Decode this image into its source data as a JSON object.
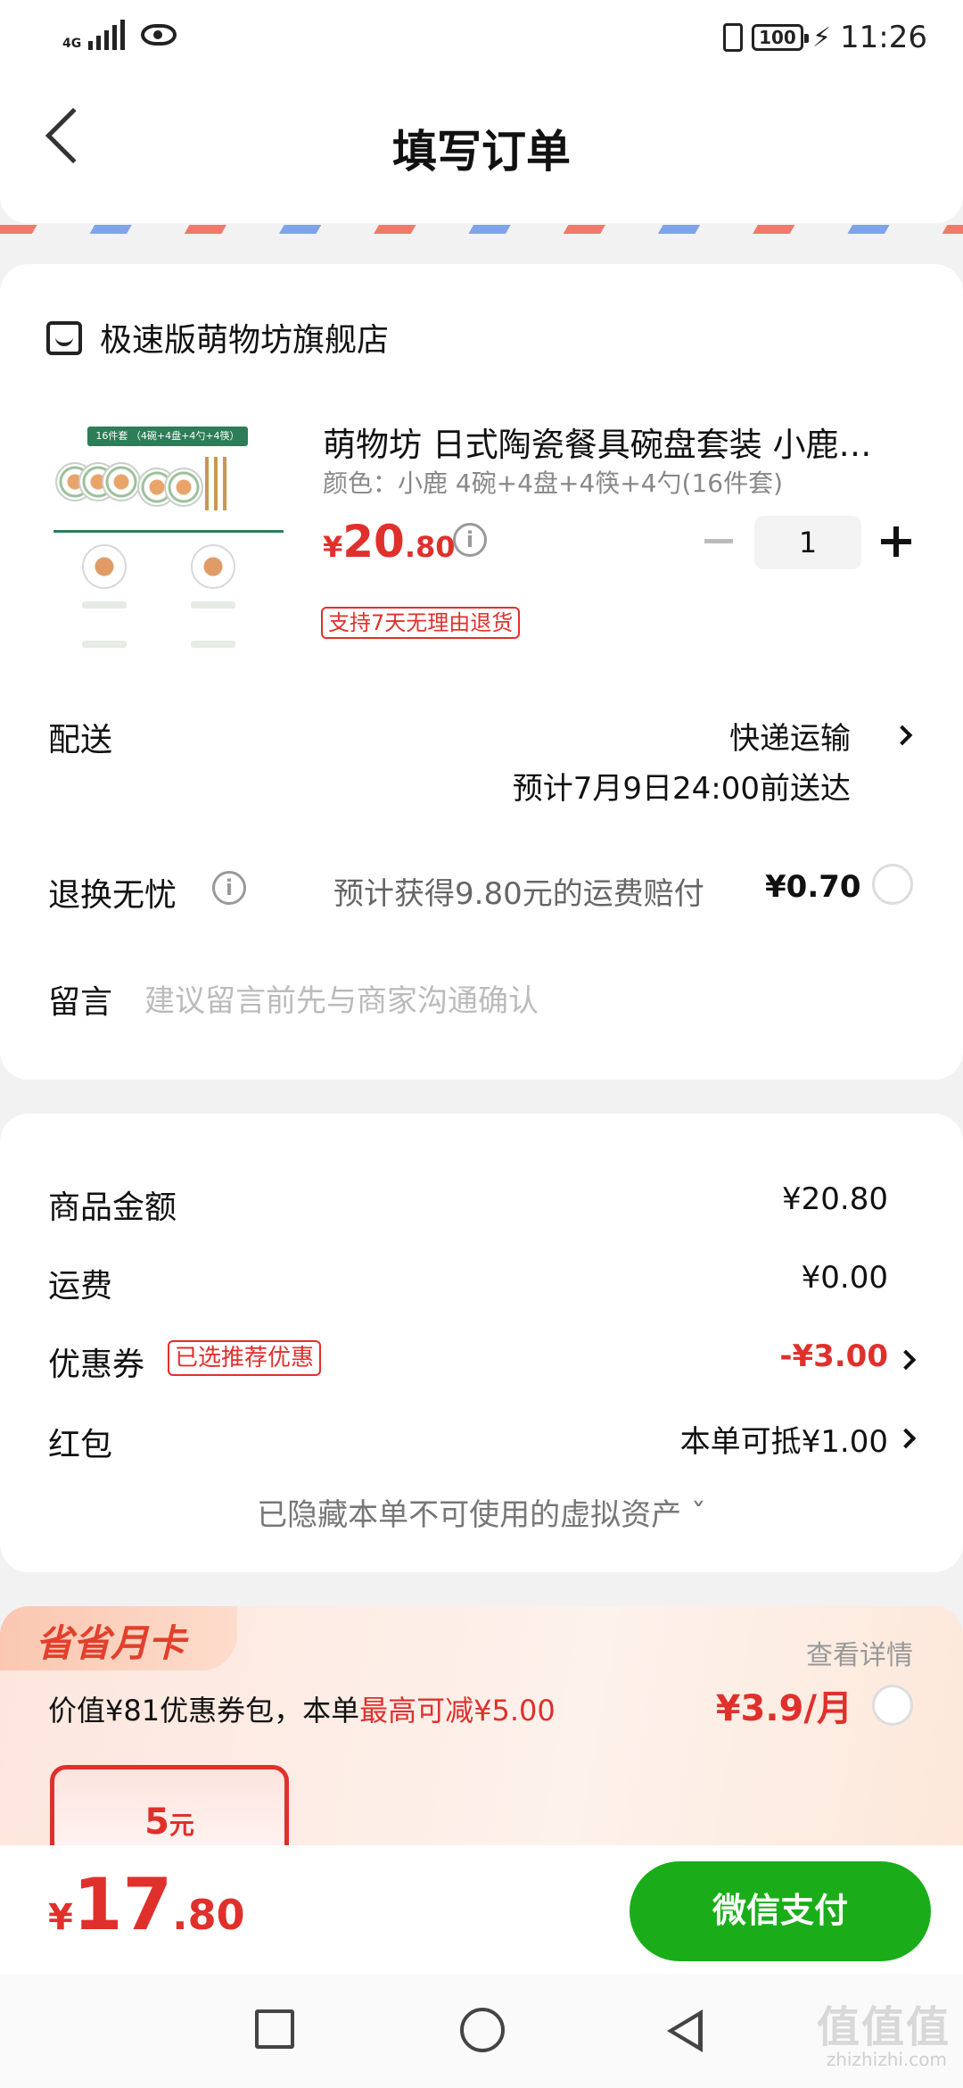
{
  "status_bar": {
    "network": "4G",
    "battery": "100",
    "time": "11:26"
  },
  "header": {
    "title": "填写订单"
  },
  "shop": {
    "name": "极速版萌物坊旗舰店"
  },
  "product": {
    "thumb_banner": "16件套 （4碗+4盘+4勺+4筷）",
    "title": "萌物坊 日式陶瓷餐具碗盘套装 小鹿…",
    "spec": "颜色：小鹿 4碗+4盘+4筷+4勺(16件套)",
    "price_currency": "¥",
    "price_int": "20",
    "price_dec": ".80",
    "quantity": "1",
    "return_badge": "支持7天无理由退货"
  },
  "delivery": {
    "label": "配送",
    "method": "快递运输",
    "eta": "预计7月9日24:00前送达"
  },
  "return_insurance": {
    "label": "退换无忧",
    "desc": "预计获得9.80元的运费赔付",
    "price": "¥0.70"
  },
  "message": {
    "label": "留言",
    "placeholder": "建议留言前先与商家沟通确认"
  },
  "summary": {
    "goods_label": "商品金额",
    "goods_value": "¥20.80",
    "shipping_label": "运费",
    "shipping_value": "¥0.00",
    "coupon_label": "优惠券",
    "coupon_badge": "已选推荐优惠",
    "coupon_value": "-¥3.00",
    "redpacket_label": "红包",
    "redpacket_value": "本单可抵¥1.00",
    "hidden_assets": "已隐藏本单不可使用的虚拟资产 ˇ"
  },
  "month_card": {
    "tag": "省省月卡",
    "detail_link": "查看详情",
    "desc_prefix": "价值¥81优惠券包，本单",
    "desc_highlight": "最高可减¥5.00",
    "price": "¥3.9/月",
    "coupon_amount": "5",
    "coupon_unit": "元"
  },
  "checkout": {
    "total_currency": "¥",
    "total_int": "17",
    "total_dec": ".80",
    "pay_label": "微信支付"
  },
  "watermark": {
    "text": "值值值",
    "sub": "zhizhizhi.com"
  },
  "colors": {
    "accent_red": "#e0302c",
    "wechat_green": "#1aad19"
  }
}
